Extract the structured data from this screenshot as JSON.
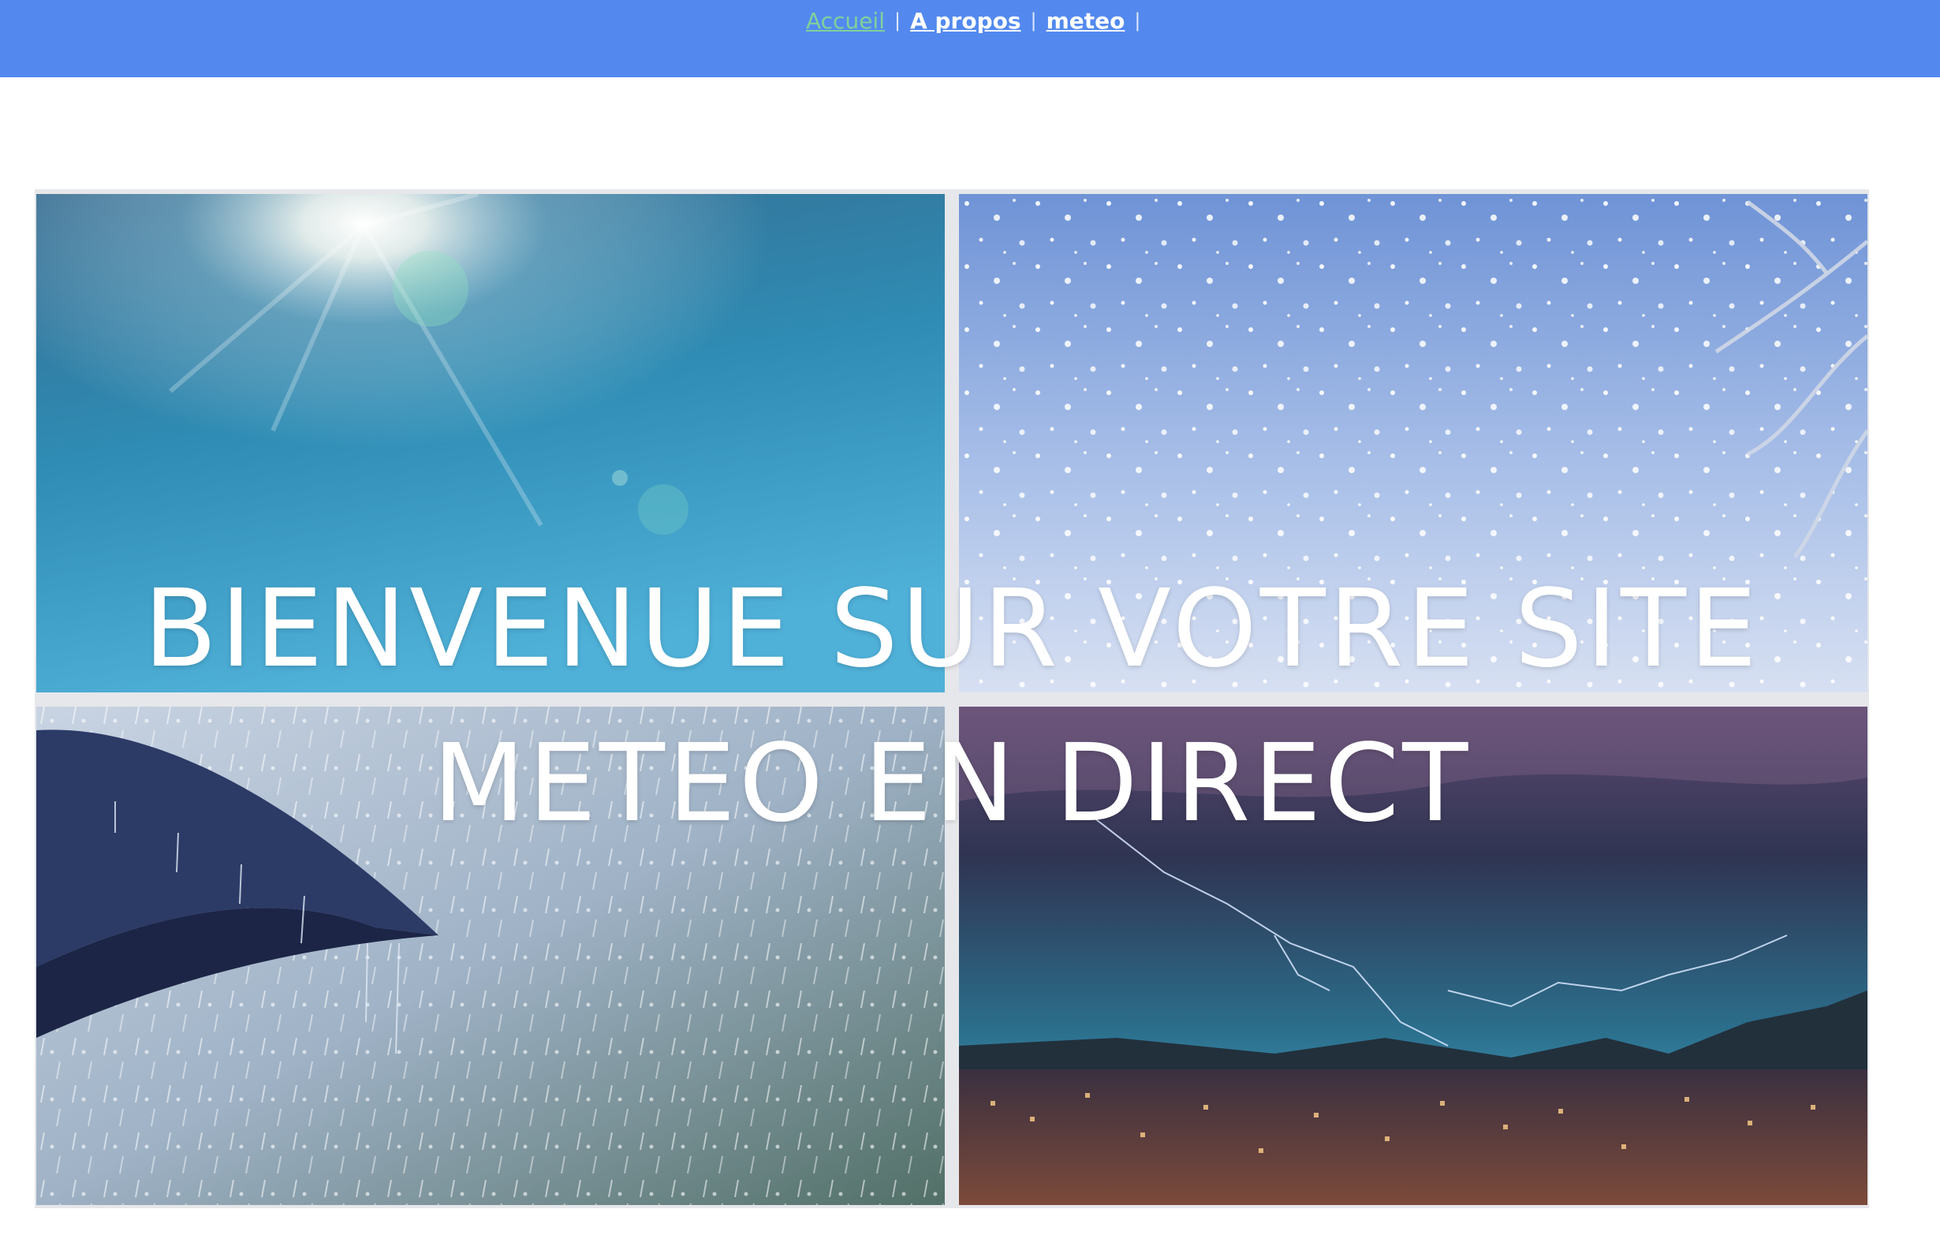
{
  "nav": {
    "links": [
      {
        "label": "Accueil",
        "active": true
      },
      {
        "label": "A propos",
        "active": false
      },
      {
        "label": "meteo",
        "active": false
      }
    ],
    "separator": "|"
  },
  "hero": {
    "title_line1": "BIENVENUE SUR VOTRE SITE",
    "title_line2": "METEO EN DIRECT"
  },
  "colors": {
    "navbar": "#5389ef",
    "active_link": "#7fd19a",
    "link": "#ffffff"
  }
}
